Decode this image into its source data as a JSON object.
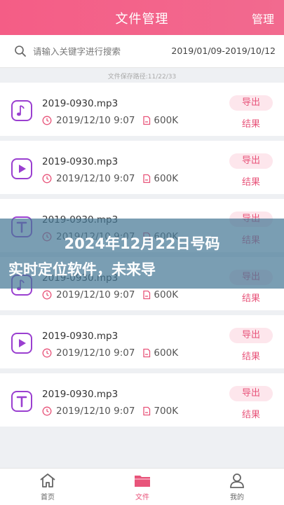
{
  "header": {
    "title": "文件管理",
    "manage_label": "管理"
  },
  "search": {
    "placeholder": "请输入关键字进行搜索",
    "date_range": "2019/01/09-2019/10/12"
  },
  "save_path": "文件保存路径:11/22/33",
  "colors": {
    "accent": "#f26a8f",
    "icon_purple": "#9a3fd0",
    "badge_bg": "#fde6ec"
  },
  "files": [
    {
      "icon": "music-note-icon",
      "name": "2019-0930.mp3",
      "time": "2019/12/10 9:07",
      "size": "600K",
      "export_label": "导出",
      "result_label": "结果"
    },
    {
      "icon": "play-icon",
      "name": "2019-0930.mp3",
      "time": "2019/12/10 9:07",
      "size": "600K",
      "export_label": "导出",
      "result_label": "结果"
    },
    {
      "icon": "text-t-icon",
      "name": "2019-0930.mp3",
      "time": "2019/12/10 9:07",
      "size": "600K",
      "export_label": "导出",
      "result_label": "结果"
    },
    {
      "icon": "music-note-icon",
      "name": "2019-0930.mp3",
      "time": "2019/12/10 9:07",
      "size": "600K",
      "export_label": "导出",
      "result_label": "结果"
    },
    {
      "icon": "play-icon",
      "name": "2019-0930.mp3",
      "time": "2019/12/10 9:07",
      "size": "600K",
      "export_label": "导出",
      "result_label": "结果"
    },
    {
      "icon": "text-t-icon",
      "name": "2019-0930.mp3",
      "time": "2019/12/10 9:07",
      "size": "700K",
      "export_label": "导出",
      "result_label": "结果"
    }
  ],
  "overlay": {
    "line1": "2024年12月22日号码",
    "line2": "实时定位软件，未来导"
  },
  "tabs": [
    {
      "icon": "home-icon",
      "label": "首页"
    },
    {
      "icon": "folder-icon",
      "label": "文件"
    },
    {
      "icon": "user-icon",
      "label": "我的"
    }
  ]
}
